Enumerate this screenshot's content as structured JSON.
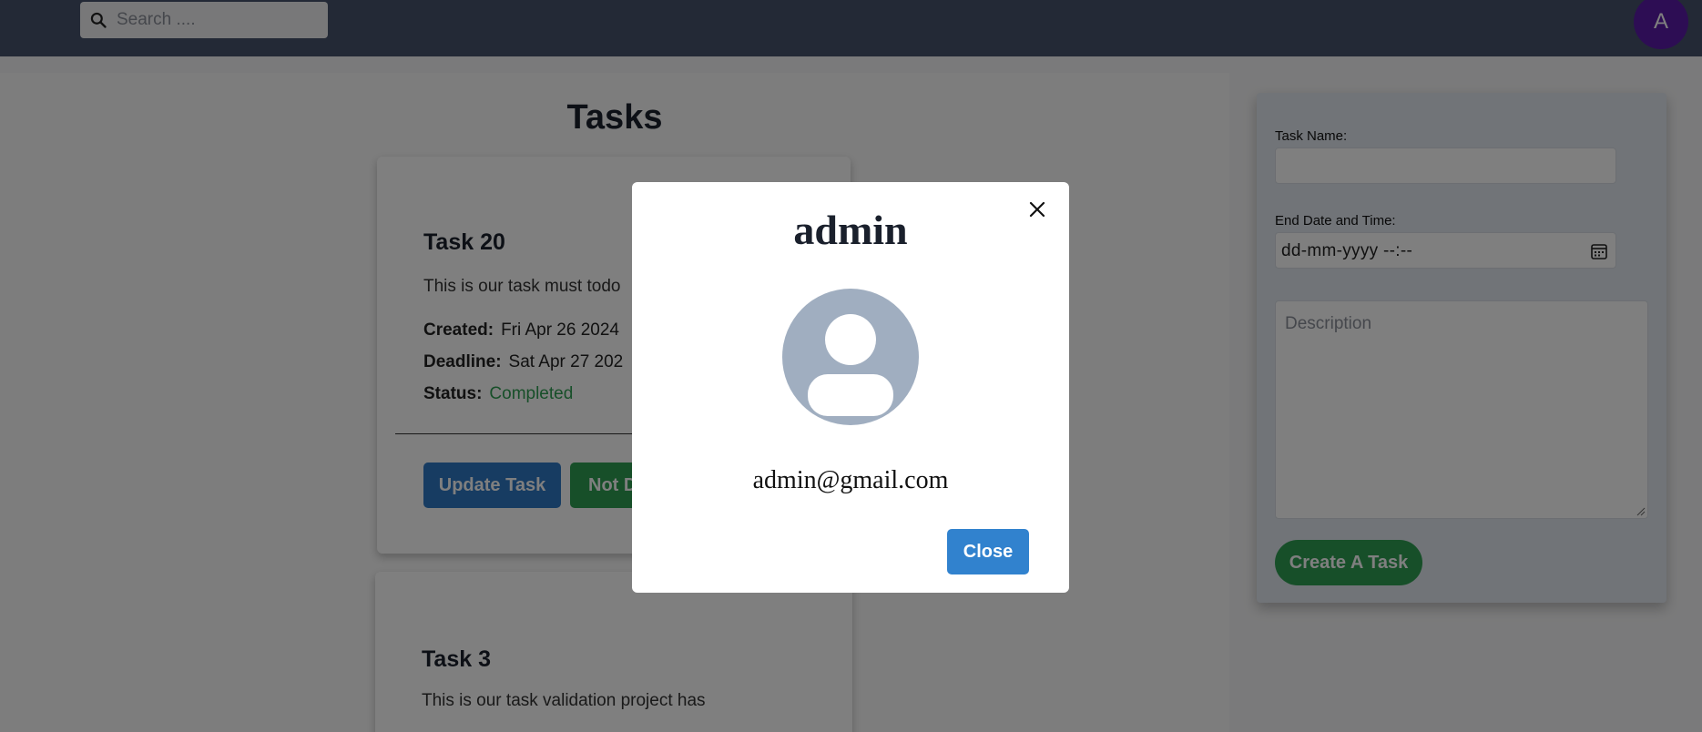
{
  "search": {
    "placeholder": "Search ...."
  },
  "user": {
    "initial": "A"
  },
  "main": {
    "title": "Tasks",
    "tasks": [
      {
        "name": "Task 20",
        "description": "This is our task must todo",
        "created_label": "Created:",
        "created": "Fri Apr 26 2024",
        "deadline_label": "Deadline:",
        "deadline": "Sat Apr 27 202",
        "status_label": "Status:",
        "status": "Completed",
        "update_label": "Update Task",
        "toggle_label": "Not D"
      },
      {
        "name": "Task 3",
        "description": "This is our task validation project has"
      }
    ]
  },
  "form": {
    "task_name_label": "Task Name:",
    "end_date_label": "End Date and Time:",
    "date_placeholder": "dd-mm-yyyy --:--",
    "description_placeholder": "Description",
    "create_label": "Create A Task"
  },
  "modal": {
    "title": "admin",
    "email": "admin@gmail.com",
    "close_label": "Close"
  },
  "colors": {
    "topbar": "#46526c",
    "avatar": "#5b1aa8",
    "primary": "#3182ce",
    "success": "#2f9e52"
  },
  "icons": [
    "search-icon",
    "calendar-icon",
    "close-icon",
    "user-placeholder-icon"
  ]
}
